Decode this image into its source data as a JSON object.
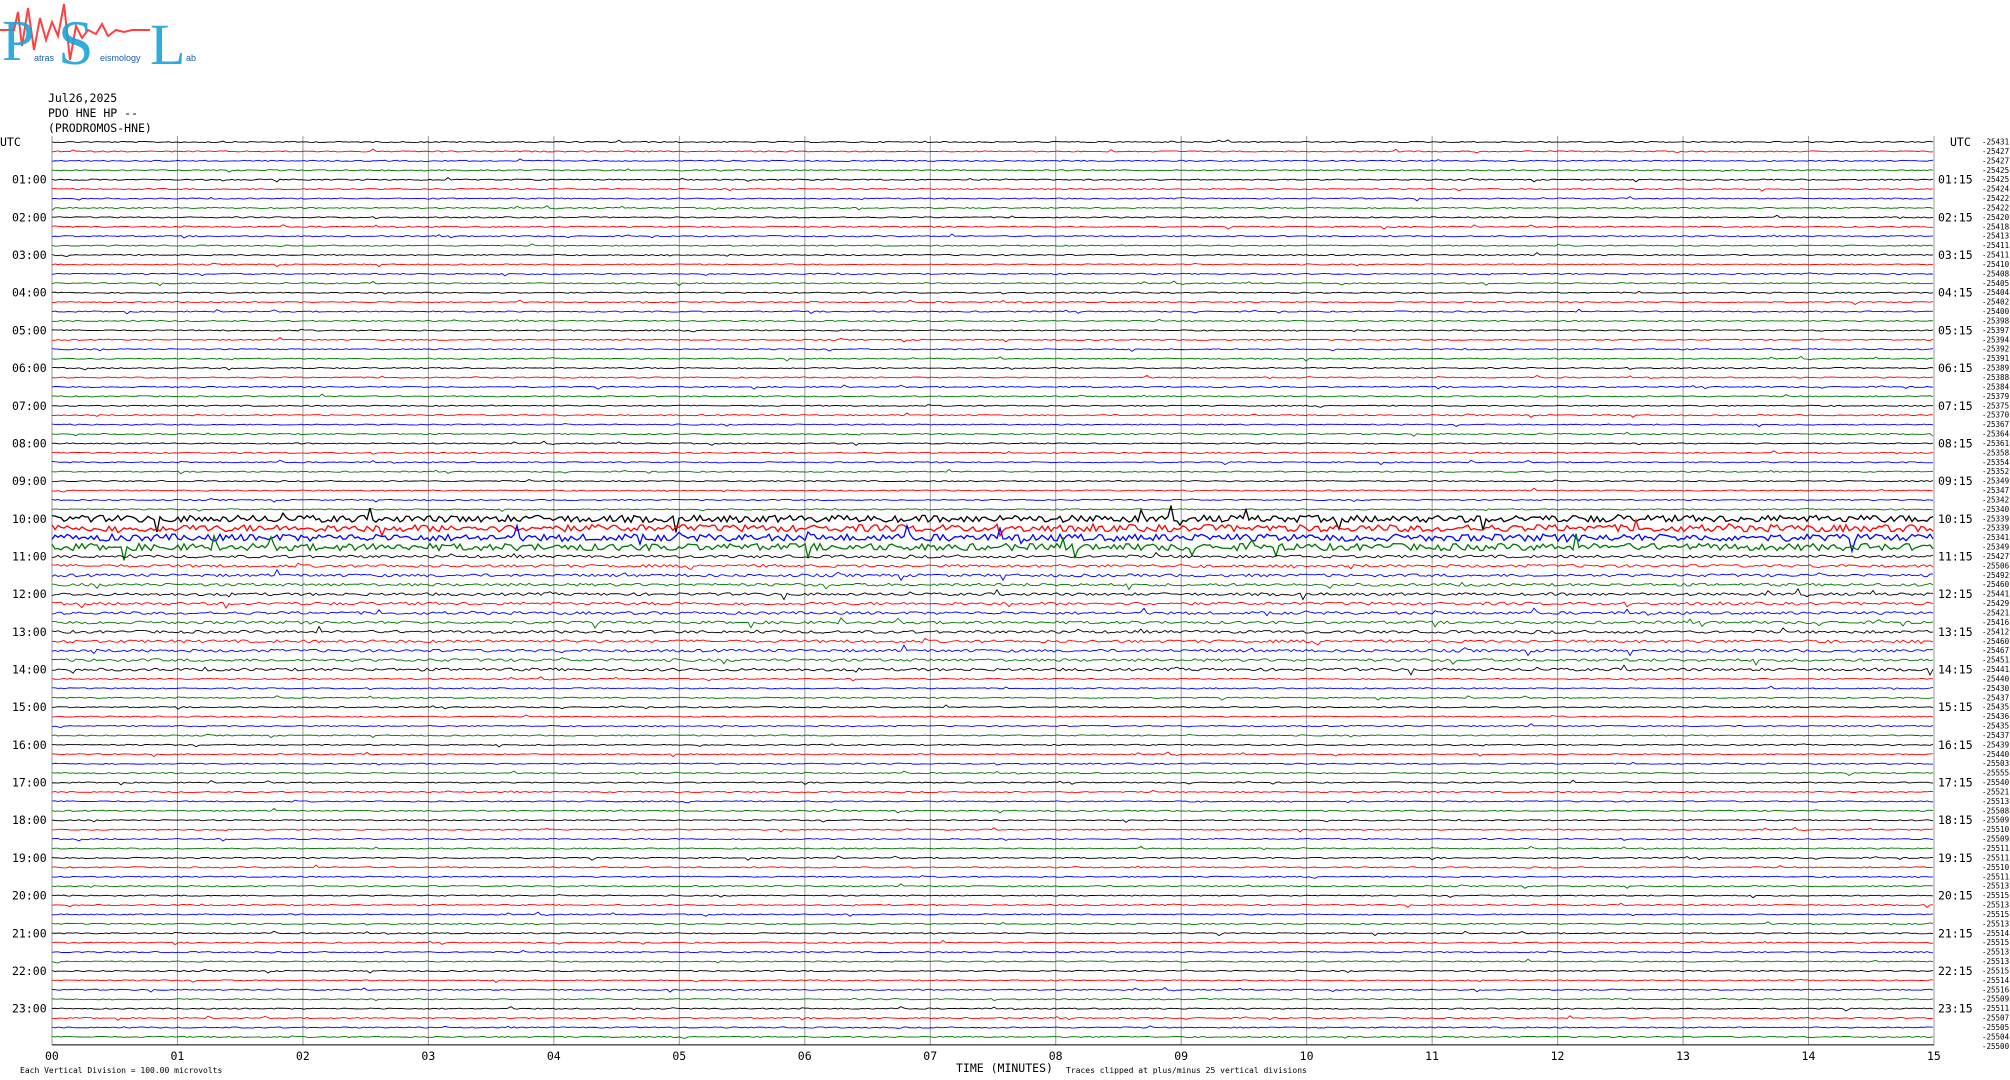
{
  "logo": {
    "letters": [
      "P",
      "S",
      "L"
    ],
    "subtext_1": "atras",
    "subtext_2": "eismology",
    "subtext_3": "ab"
  },
  "header": {
    "date": "Jul26,2025",
    "station": "PDO HNE HP --",
    "network": "(PRODROMOS-HNE)"
  },
  "axes": {
    "left_label": "UTC",
    "right_label": "UTC",
    "x_title": "TIME (MINUTES)",
    "footer_left": "Each Vertical Division =  100.00 microvolts",
    "footer_mid": "Traces clipped at plus/minus 25 vertical divisions"
  },
  "colors": {
    "cycle": [
      "#000000",
      "#ff0000",
      "#0000ff",
      "#007700"
    ],
    "grid": "#999999"
  },
  "chart_data": {
    "type": "line",
    "title": "",
    "xlabel": "TIME (MINUTES)",
    "xlim": [
      0,
      15
    ],
    "x_ticks": [
      "00",
      "01",
      "02",
      "03",
      "04",
      "05",
      "06",
      "07",
      "08",
      "09",
      "10",
      "11",
      "12",
      "13",
      "14",
      "15"
    ],
    "line_count": 96,
    "minutes_per_line": 15,
    "left_hour_labels": [
      "01:00",
      "02:00",
      "03:00",
      "04:00",
      "05:00",
      "06:00",
      "07:00",
      "08:00",
      "09:00",
      "10:00",
      "11:00",
      "12:00",
      "13:00",
      "14:00",
      "15:00",
      "16:00",
      "17:00",
      "18:00",
      "19:00",
      "20:00",
      "21:00",
      "22:00",
      "23:00"
    ],
    "right_hour_labels": [
      "01:15",
      "02:15",
      "03:15",
      "04:15",
      "05:15",
      "06:15",
      "07:15",
      "08:15",
      "09:15",
      "10:15",
      "11:15",
      "12:15",
      "13:15",
      "14:15",
      "15:15",
      "16:15",
      "17:15",
      "18:15",
      "19:15",
      "20:15",
      "21:15",
      "22:15",
      "23:15"
    ],
    "offset_labels": [
      "-25431",
      "-25427",
      "-25427",
      "-25425",
      "-25425",
      "-25424",
      "-25422",
      "-25422",
      "-25420",
      "-25418",
      "-25413",
      "-25411",
      "-25411",
      "-25410",
      "-25408",
      "-25405",
      "-25404",
      "-25402",
      "-25400",
      "-25398",
      "-25397",
      "-25394",
      "-25392",
      "-25391",
      "-25389",
      "-25388",
      "-25384",
      "-25379",
      "-25375",
      "-25370",
      "-25367",
      "-25364",
      "-25361",
      "-25358",
      "-25354",
      "-25352",
      "-25349",
      "-25347",
      "-25342",
      "-25340",
      "-25339",
      "-25339",
      "-25341",
      "-25349",
      "-25427",
      "-25506",
      "-25492",
      "-25460",
      "-25441",
      "-25429",
      "-25421",
      "-25416",
      "-25412",
      "-25460",
      "-25467",
      "-25451",
      "-25441",
      "-25440",
      "-25430",
      "-25437",
      "-25435",
      "-25436",
      "-25435",
      "-25437",
      "-25439",
      "-25440",
      "-25503",
      "-25555",
      "-25540",
      "-25521",
      "-25513",
      "-25508",
      "-25509",
      "-25510",
      "-25509",
      "-25511",
      "-25511",
      "-25510",
      "-25511",
      "-25513",
      "-25515",
      "-25513",
      "-25515",
      "-25513",
      "-25514",
      "-25515",
      "-25513",
      "-25513",
      "-25515",
      "-25514",
      "-25516",
      "-25509",
      "-25511",
      "-25507",
      "-25505",
      "-25504",
      "-25500"
    ]
  }
}
